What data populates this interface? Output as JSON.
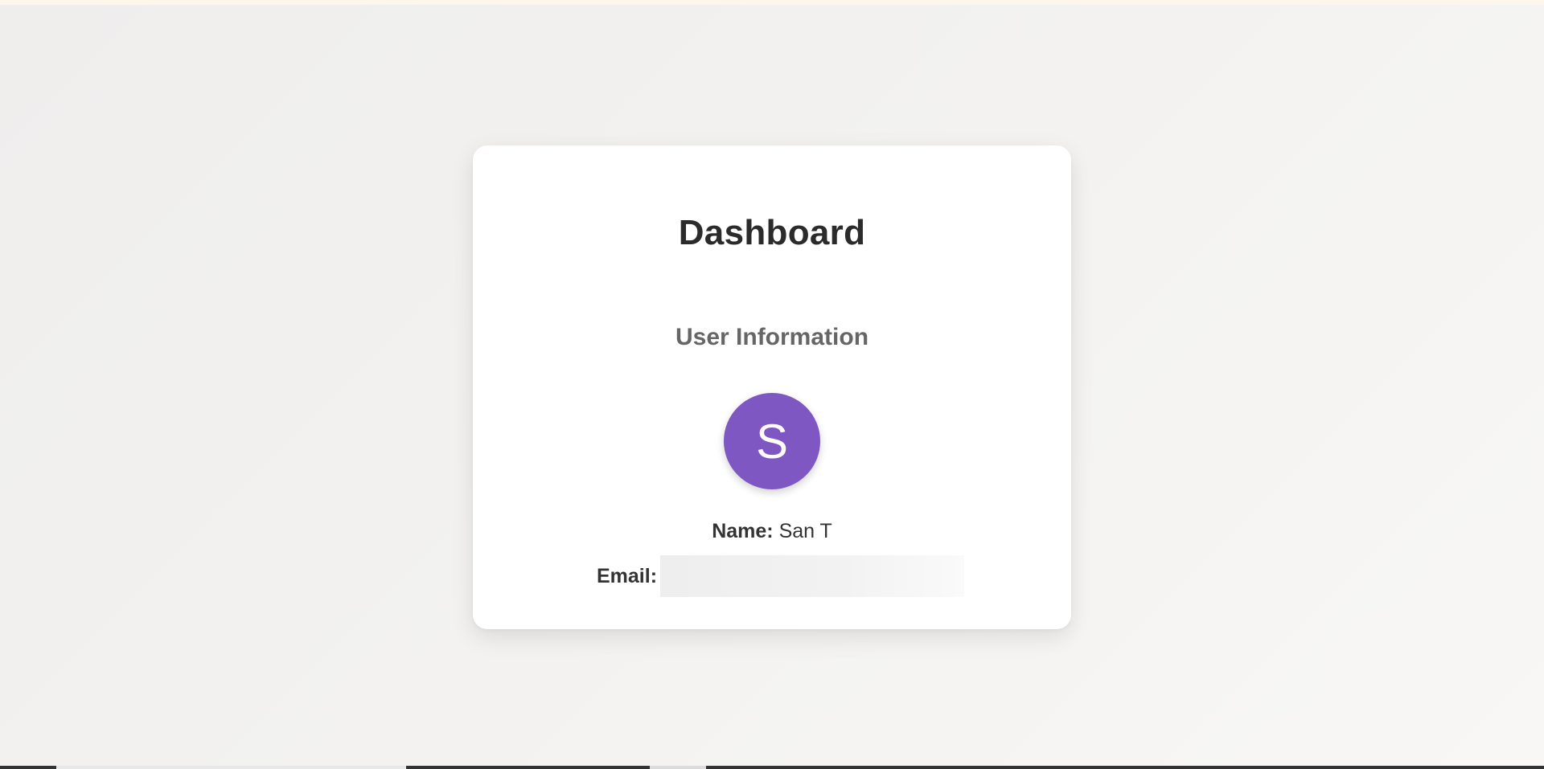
{
  "main": {
    "title": "Dashboard",
    "section_title": "User Information",
    "avatar": {
      "initial": "S",
      "color": "#7e57c2"
    },
    "name_label": "Name:",
    "name_value": "San T",
    "email_label": "Email:",
    "email_value": ""
  },
  "colors": {
    "background": "#f2f1ef",
    "card": "#ffffff",
    "title_text": "#2b2b2b",
    "subtitle_text": "#666666"
  }
}
